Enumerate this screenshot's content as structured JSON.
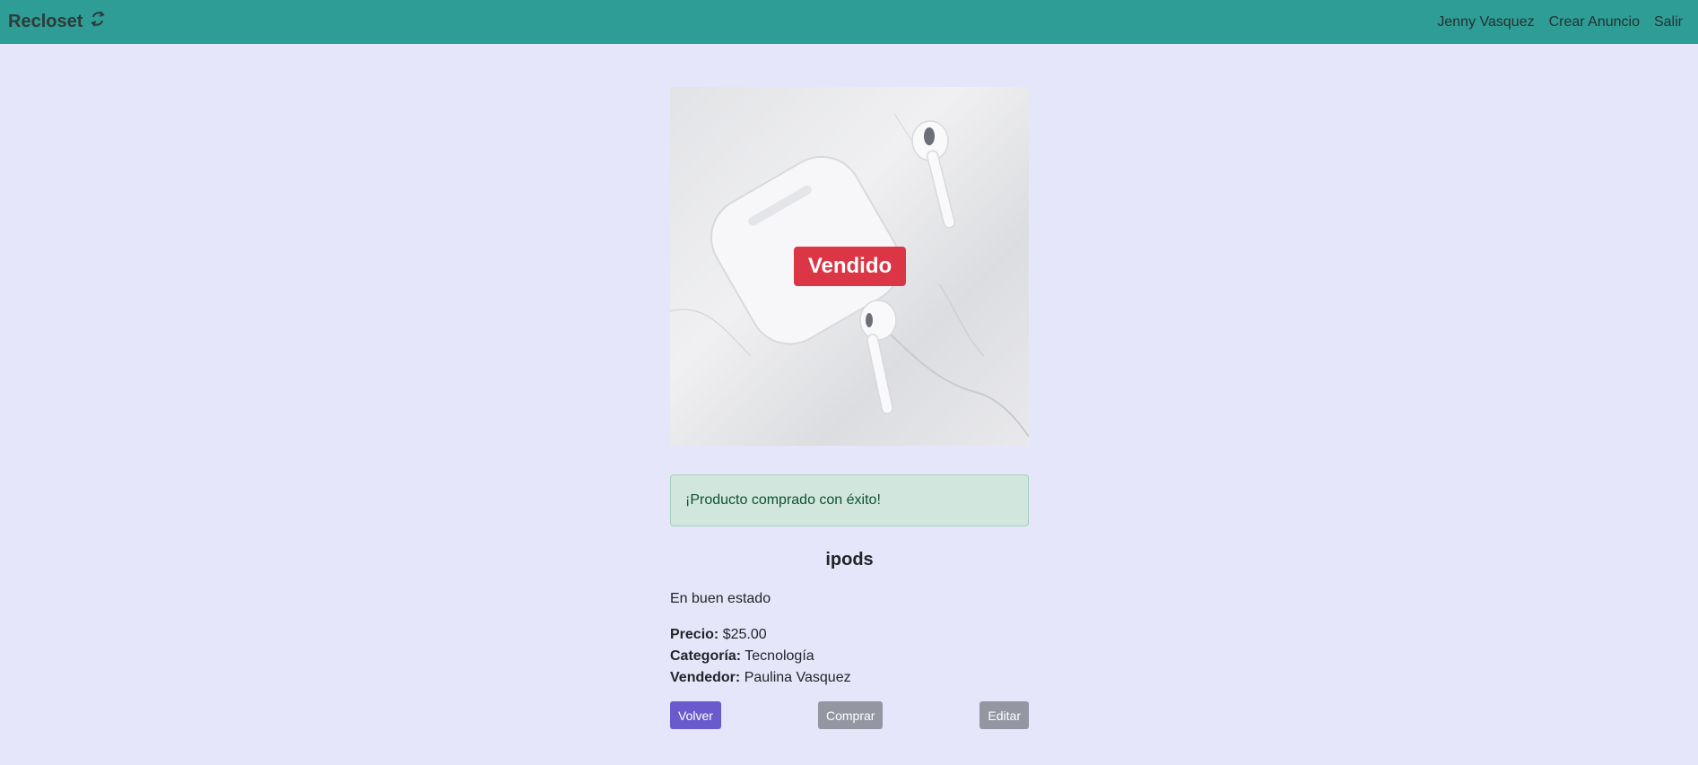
{
  "navbar": {
    "brand": "Recloset",
    "brand_icon": "recycle-icon",
    "links": [
      {
        "label": "Jenny Vasquez"
      },
      {
        "label": "Crear Anuncio"
      },
      {
        "label": "Salir"
      }
    ],
    "bg_color": "#2e9d96"
  },
  "product": {
    "image_alt": "AirPods",
    "status_badge": "Vendido",
    "alert_message": "¡Producto comprado con éxito!",
    "title": "ipods",
    "description": "En buen estado",
    "price_label": "Precio:",
    "price_value": "$25.00",
    "category_label": "Categoría:",
    "category_value": "Tecnología",
    "seller_label": "Vendedor:",
    "seller_value": "Paulina Vasquez"
  },
  "actions": {
    "back": "Volver",
    "buy": "Comprar",
    "edit": "Editar"
  },
  "colors": {
    "background": "#e6e6fa",
    "badge": "#dc3545",
    "alert_bg": "#d1e7dd",
    "primary_button": "#6a5acd",
    "secondary_button": "#9497a2"
  }
}
